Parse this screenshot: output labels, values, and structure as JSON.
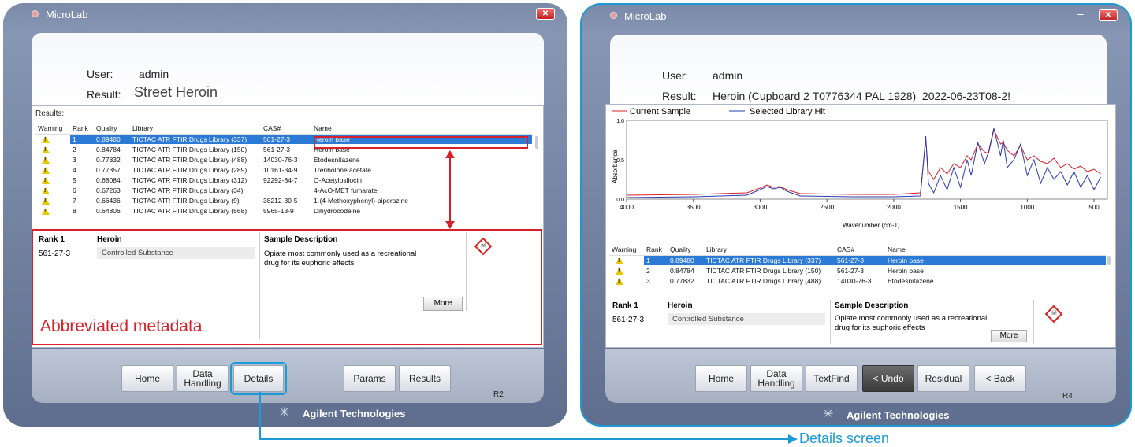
{
  "colors": {
    "accent": "#1b9ad6",
    "annotation": "#d8202a",
    "selection": "#2a7ad6",
    "current_sample": "#d8202a",
    "library_hit": "#2a3ab0"
  },
  "left": {
    "app_title": "MicroLab",
    "user_label": "User:",
    "user_value": "admin",
    "result_label": "Result:",
    "result_value": "Street Heroin",
    "results_label": "Results:",
    "columns": [
      "Warning",
      "Rank",
      "Quality",
      "Library",
      "CAS#",
      "Name"
    ],
    "rows": [
      {
        "rank": "1",
        "quality": "0.89480",
        "library": "TICTAC ATR FTIR Drugs Library (337)",
        "cas": "561-27-3",
        "name": "Heroin base"
      },
      {
        "rank": "2",
        "quality": "0.84784",
        "library": "TICTAC ATR FTIR Drugs Library (150)",
        "cas": "561-27-3",
        "name": "Heroin base"
      },
      {
        "rank": "3",
        "quality": "0.77832",
        "library": "TICTAC ATR FTIR Drugs Library (488)",
        "cas": "14030-76-3",
        "name": "Etodesnitazene"
      },
      {
        "rank": "4",
        "quality": "0.77357",
        "library": "TICTAC ATR FTIR Drugs Library (289)",
        "cas": "10161-34-9",
        "name": "Trenbolone acetate"
      },
      {
        "rank": "5",
        "quality": "0.68084",
        "library": "TICTAC ATR FTIR Drugs Library (312)",
        "cas": "92292-84-7",
        "name": "O-Acetylpsilocin"
      },
      {
        "rank": "6",
        "quality": "0.67263",
        "library": "TICTAC ATR FTIR Drugs Library (34)",
        "cas": "",
        "name": "4-AcO-MET fumarate"
      },
      {
        "rank": "7",
        "quality": "0.66436",
        "library": "TICTAC ATR FTIR Drugs Library (9)",
        "cas": "38212-30-5",
        "name": "1-(4-Methoxyphenyl)-piperazine"
      },
      {
        "rank": "8",
        "quality": "0.64806",
        "library": "TICTAC ATR FTIR Drugs Library (568)",
        "cas": "5965-13-9",
        "name": "Dihydrocodeine"
      }
    ],
    "detail": {
      "rank": "Rank 1",
      "name": "Heroin",
      "cas": "561-27-3",
      "status": "Controlled Substance",
      "sd_label": "Sample Description",
      "sd_text_1": "Opiate most commonly used as a recreational",
      "sd_text_2": "drug for its euphoric effects",
      "more": "More"
    },
    "annotation": "Abbreviated metadata",
    "nav": {
      "home": "Home",
      "data_1": "Data",
      "data_2": "Handling",
      "details": "Details",
      "params": "Params",
      "results": "Results"
    },
    "revision": "R2",
    "brand": "Agilent Technologies"
  },
  "right": {
    "app_title": "MicroLab",
    "user_label": "User:",
    "user_value": "admin",
    "result_label": "Result:",
    "result_value": "Heroin (Cupboard 2 T0776344 PAL 1928)_2022-06-23T08-2!",
    "legend_current": "Current Sample",
    "legend_library": "Selected Library Hit",
    "columns": [
      "Warning",
      "Rank",
      "Quality",
      "Library",
      "CAS#",
      "Name"
    ],
    "rows": [
      {
        "rank": "1",
        "quality": "0.89480",
        "library": "TICTAC ATR FTIR Drugs Library (337)",
        "cas": "561-27-3",
        "name": "Heroin base"
      },
      {
        "rank": "2",
        "quality": "0.84784",
        "library": "TICTAC ATR FTIR Drugs Library (150)",
        "cas": "561-27-3",
        "name": "Heroin base"
      },
      {
        "rank": "3",
        "quality": "0.77832",
        "library": "TICTAC ATR FTIR Drugs Library (488)",
        "cas": "14030-76-3",
        "name": "Etodesnitazene"
      }
    ],
    "detail": {
      "rank": "Rank 1",
      "name": "Heroin",
      "cas": "561-27-3",
      "status": "Controlled Substance",
      "sd_label": "Sample Description",
      "sd_text_1": "Opiate most commonly used as a recreational",
      "sd_text_2": "drug for its euphoric effects",
      "more": "More"
    },
    "nav": {
      "home": "Home",
      "data_1": "Data",
      "data_2": "Handling",
      "textfind": "TextFind",
      "undo": "< Undo",
      "residual": "Residual",
      "back": "< Back"
    },
    "revision": "R4",
    "brand": "Agilent Technologies"
  },
  "callout": "Details screen",
  "chart_data": {
    "type": "line",
    "xlabel": "Wavenumber (cm-1)",
    "ylabel": "Absorbance",
    "xlim": [
      4000,
      400
    ],
    "ylim": [
      0.0,
      1.0
    ],
    "x_ticks": [
      "4000",
      "3500",
      "3000",
      "2500",
      "2000",
      "1500",
      "1000",
      "500"
    ],
    "y_ticks": [
      "0.0",
      "0.5",
      "1.0"
    ],
    "series": [
      {
        "name": "Current Sample",
        "x": [
          4000,
          3500,
          3100,
          3000,
          2950,
          2900,
          2850,
          2800,
          2700,
          2300,
          2000,
          1800,
          1760,
          1740,
          1700,
          1650,
          1600,
          1550,
          1500,
          1450,
          1420,
          1370,
          1320,
          1290,
          1250,
          1200,
          1180,
          1150,
          1100,
          1050,
          1000,
          950,
          900,
          850,
          800,
          750,
          700,
          650,
          600,
          550,
          500,
          450
        ],
        "y": [
          0.05,
          0.06,
          0.08,
          0.14,
          0.18,
          0.15,
          0.16,
          0.12,
          0.07,
          0.06,
          0.06,
          0.08,
          0.75,
          0.35,
          0.25,
          0.4,
          0.32,
          0.45,
          0.4,
          0.55,
          0.5,
          0.7,
          0.6,
          0.58,
          0.88,
          0.7,
          0.72,
          0.62,
          0.55,
          0.68,
          0.5,
          0.55,
          0.48,
          0.45,
          0.52,
          0.4,
          0.45,
          0.38,
          0.42,
          0.35,
          0.38,
          0.32
        ]
      },
      {
        "name": "Selected Library Hit",
        "x": [
          4000,
          3500,
          3100,
          3000,
          2950,
          2900,
          2850,
          2800,
          2700,
          2300,
          2000,
          1800,
          1760,
          1740,
          1700,
          1650,
          1600,
          1550,
          1500,
          1450,
          1420,
          1370,
          1320,
          1290,
          1250,
          1200,
          1180,
          1150,
          1100,
          1050,
          1000,
          950,
          900,
          850,
          800,
          750,
          700,
          650,
          600,
          550,
          500,
          450
        ],
        "y": [
          0.02,
          0.03,
          0.05,
          0.12,
          0.16,
          0.13,
          0.15,
          0.1,
          0.04,
          0.03,
          0.03,
          0.04,
          0.8,
          0.2,
          0.08,
          0.3,
          0.12,
          0.4,
          0.15,
          0.5,
          0.3,
          0.72,
          0.45,
          0.6,
          0.9,
          0.55,
          0.75,
          0.4,
          0.5,
          0.7,
          0.3,
          0.5,
          0.2,
          0.4,
          0.25,
          0.35,
          0.18,
          0.35,
          0.15,
          0.3,
          0.12,
          0.28
        ]
      }
    ]
  }
}
